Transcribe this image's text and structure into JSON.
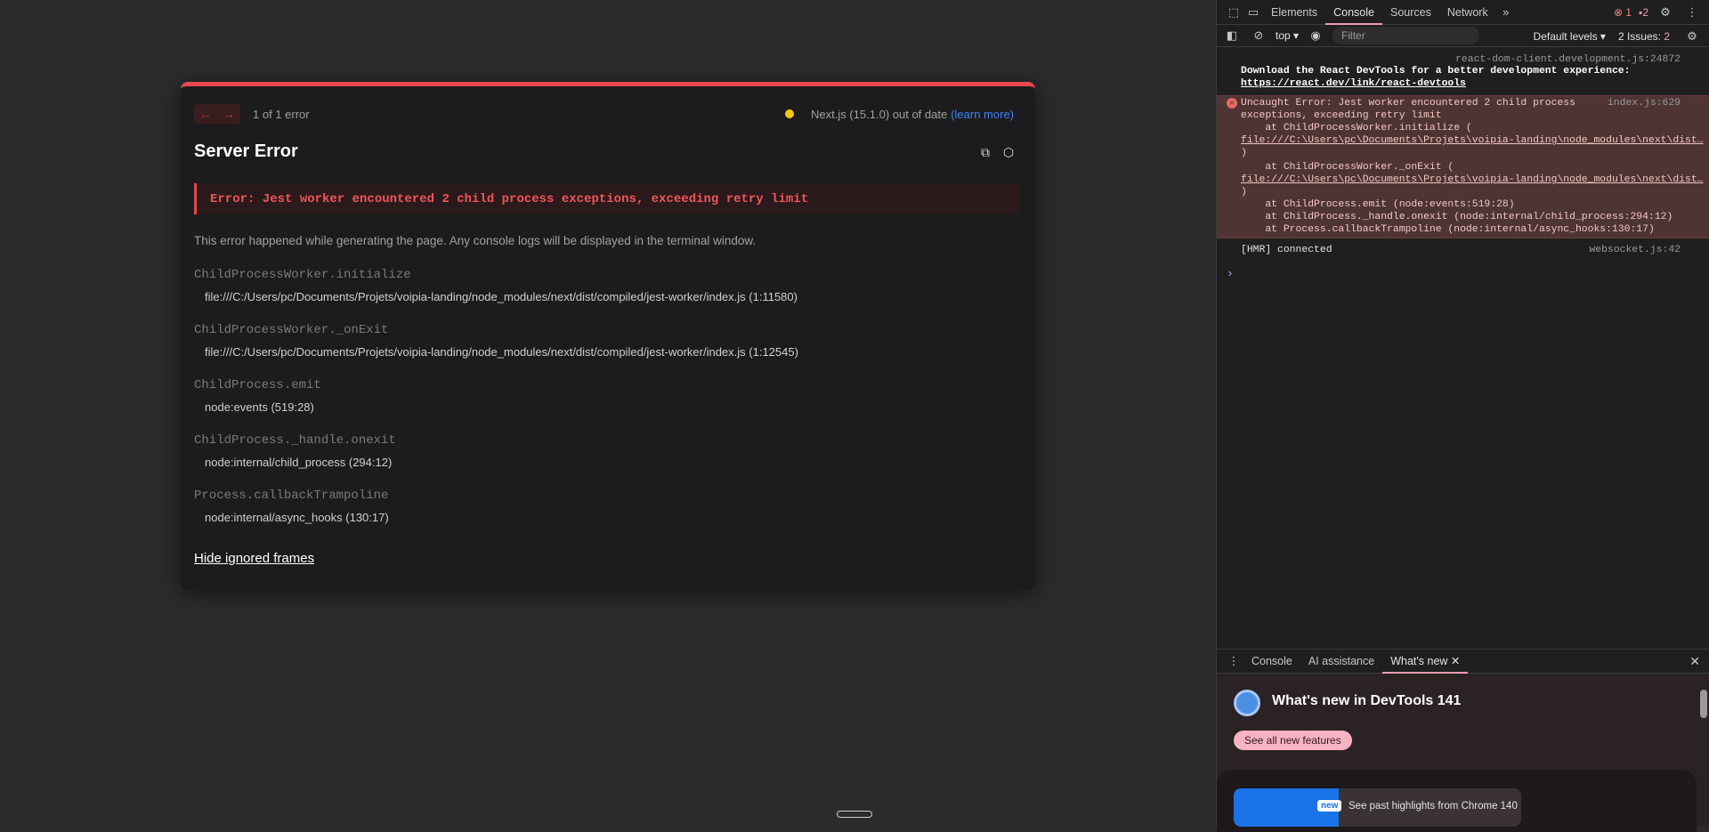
{
  "overlay": {
    "nav_prev": "←",
    "nav_next": "→",
    "error_count": "1 of 1 error",
    "version_text": "Next.js (15.1.0) out of date",
    "learn_more": "(learn more)",
    "title": "Server Error",
    "error_message": "Error: Jest worker encountered 2 child process exceptions, exceeding retry limit",
    "description": "This error happened while generating the page. Any console logs will be displayed in the terminal window.",
    "frames": [
      {
        "fn": "ChildProcessWorker.initialize",
        "loc": "file:///C:/Users/pc/Documents/Projets/voipia-landing/node_modules/next/dist/compiled/jest-worker/index.js (1:11580)"
      },
      {
        "fn": "ChildProcessWorker._onExit",
        "loc": "file:///C:/Users/pc/Documents/Projets/voipia-landing/node_modules/next/dist/compiled/jest-worker/index.js (1:12545)"
      },
      {
        "fn": "ChildProcess.emit",
        "loc": "node:events (519:28)"
      },
      {
        "fn": "ChildProcess._handle.onexit",
        "loc": "node:internal/child_process (294:12)"
      },
      {
        "fn": "Process.callbackTrampoline",
        "loc": "node:internal/async_hooks (130:17)"
      }
    ],
    "hide_frames": "Hide ignored frames"
  },
  "devtools": {
    "tabs": [
      "Elements",
      "Console",
      "Sources",
      "Network"
    ],
    "more": "»",
    "error_badge": "1",
    "warning_badge": "2",
    "toolbar": {
      "context": "top ▾",
      "filter_placeholder": "Filter",
      "levels": "Default levels ▾",
      "issues": "2 Issues: ",
      "issues_count": "2"
    },
    "console": {
      "msg1_src": "react-dom-client.development.js:24872",
      "msg1_line1": "Download the React DevTools for a better development experience:",
      "msg1_link": "https://react.dev/link/react-devtools",
      "err_src": "index.js:629",
      "err_lines": [
        "Uncaught Error: Jest worker encountered 2 child process",
        "exceptions, exceeding retry limit",
        "    at ChildProcessWorker.initialize (",
        "file:///C:\\Users\\pc\\Documents\\Projets\\voipia-landing\\node_modules\\next\\dist…",
        ")",
        "    at ChildProcessWorker._onExit (",
        "file:///C:\\Users\\pc\\Documents\\Projets\\voipia-landing\\node_modules\\next\\dist…",
        ")",
        "    at ChildProcess.emit (node:events:519:28)",
        "    at ChildProcess._handle.onexit (node:internal/child_process:294:12)",
        "    at Process.callbackTrampoline (node:internal/async_hooks:130:17)"
      ],
      "hmr_text": "[HMR] connected",
      "hmr_src": "websocket.js:42",
      "prompt": "›"
    },
    "drawer": {
      "tabs": [
        "Console",
        "AI assistance",
        "What's new"
      ],
      "close": "✕"
    },
    "whatsnew": {
      "title": "What's new in DevTools 141",
      "button": "See all new features",
      "badge": "new",
      "item_text": "See past highlights from Chrome 140"
    }
  }
}
